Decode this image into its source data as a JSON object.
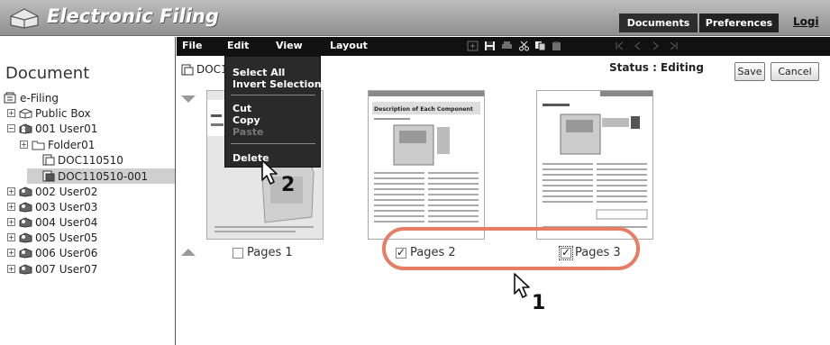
{
  "header": {
    "app_title": "Electronic Filing",
    "documents_tab": "Documents",
    "preferences_tab": "Preferences",
    "logout_label": "Logi"
  },
  "menubar": {
    "file": "File",
    "edit": "Edit",
    "view": "View",
    "layout": "Layout",
    "toolbar_icons": [
      "insert-page-icon",
      "save-icon",
      "print-icon",
      "cut-icon",
      "copy-icon",
      "paste-icon",
      "first-page-icon",
      "prev-page-icon",
      "next-page-icon",
      "last-page-icon"
    ]
  },
  "sidebar": {
    "heading": "Document",
    "items": [
      {
        "label": "e-Filing",
        "icon": "efiling-icon"
      },
      {
        "label": "Public Box",
        "icon": "box-icon"
      },
      {
        "label": "001 User01",
        "icon": "userbox-icon"
      },
      {
        "label": "Folder01",
        "icon": "folder-icon"
      },
      {
        "label": "DOC110510",
        "icon": "document-icon"
      },
      {
        "label": "DOC110510-001",
        "icon": "document-icon"
      },
      {
        "label": "002 User02",
        "icon": "userbox-icon"
      },
      {
        "label": "003 User03",
        "icon": "userbox-icon"
      },
      {
        "label": "004 User04",
        "icon": "userbox-icon"
      },
      {
        "label": "005 User05",
        "icon": "userbox-icon"
      },
      {
        "label": "006 User06",
        "icon": "userbox-icon"
      },
      {
        "label": "007 User07",
        "icon": "userbox-icon"
      }
    ]
  },
  "main": {
    "doc_name": "DOC1",
    "status": "Status : Editing",
    "save_label": "Save",
    "cancel_label": "Cancel",
    "pages": [
      {
        "label": "Pages 1",
        "checked": false
      },
      {
        "label": "Pages 2",
        "checked": true
      },
      {
        "label": "Pages 3",
        "checked": true
      }
    ],
    "page2_heading": "Description of Each Component"
  },
  "edit_menu": {
    "select_all": "Select All",
    "invert_selection": "Invert Selection",
    "cut": "Cut",
    "copy": "Copy",
    "paste": "Paste",
    "delete": "Delete"
  },
  "steps": {
    "step1": "1",
    "step2": "2"
  },
  "colors": {
    "highlight": "#e87d66",
    "menubar": "#111111",
    "selected_row": "#cfcfcf"
  }
}
